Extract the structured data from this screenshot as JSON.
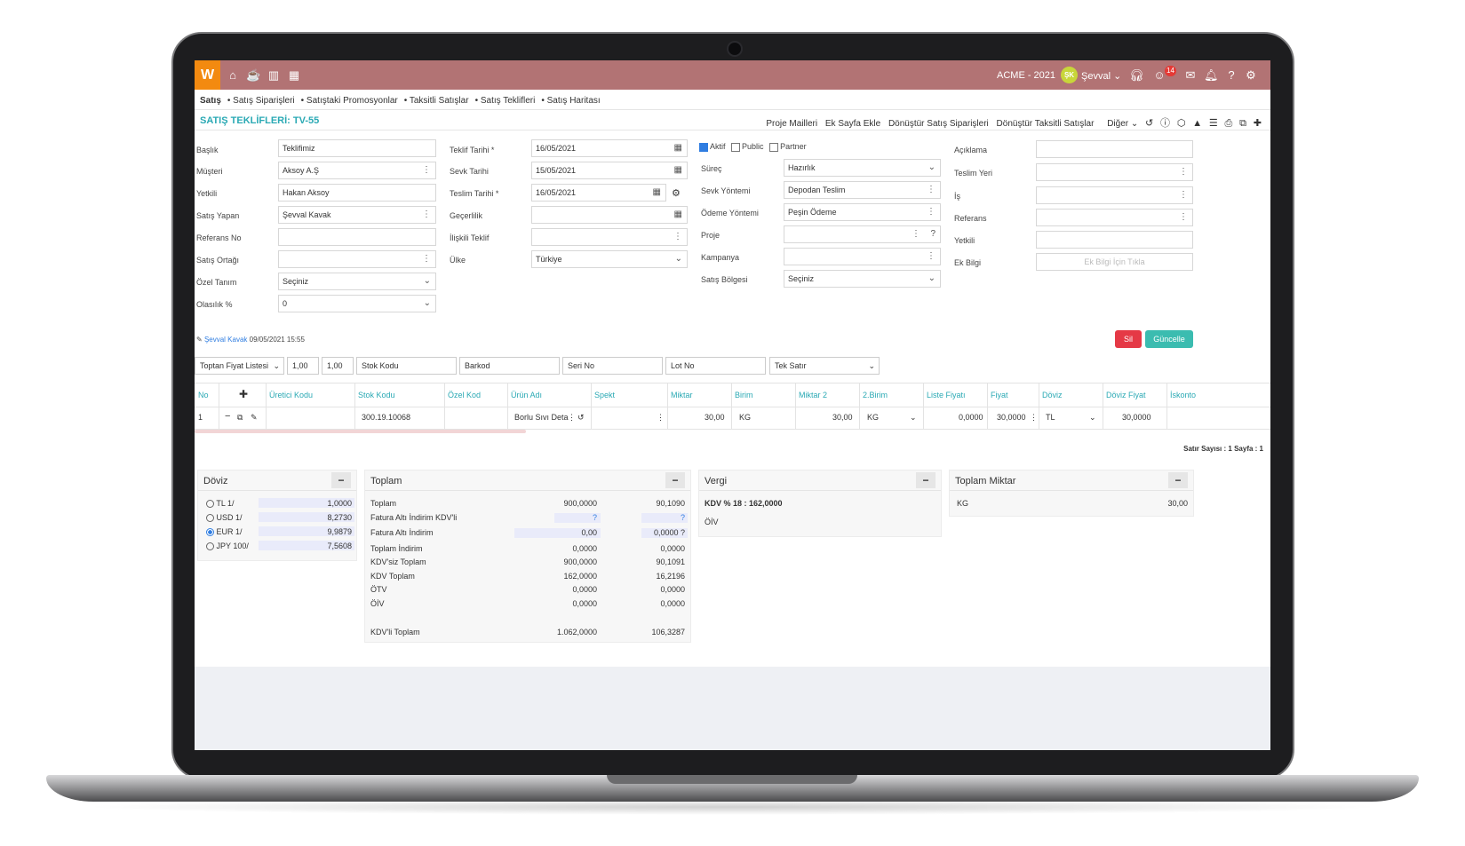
{
  "topbar": {
    "logo": "W",
    "company": "ACME - 2021",
    "avatar_initials": "ŞK",
    "user": "Şevval",
    "notif_count": "14",
    "color": "#b27374",
    "logo_color": "#f38a10",
    "icons": [
      "home-icon",
      "coffee-icon",
      "bar-chart-icon",
      "calendar-icon",
      "headset-icon",
      "smiley-icon",
      "chat-icon",
      "bell-icon",
      "help-icon",
      "gear-icon"
    ]
  },
  "breadcrumb": [
    "Satış",
    "• Satış Siparişleri",
    "• Satıştaki Promosyonlar",
    "• Taksitli Satışlar",
    "• Satış Teklifleri",
    "• Satış Haritası"
  ],
  "page": {
    "title": "SATIŞ TEKLİFLERİ: TV-55",
    "actions": [
      "Proje Mailleri",
      "Ek Sayfa Ekle",
      "Dönüştür Satış Siparişleri",
      "Dönüştür Taksitli Satışlar",
      "Diğer"
    ]
  },
  "form": {
    "col1": [
      {
        "label": "Başlık",
        "value": "Teklifimiz"
      },
      {
        "label": "Müşteri",
        "value": "Aksoy A.Ş"
      },
      {
        "label": "Yetkili",
        "value": "Hakan Aksoy"
      },
      {
        "label": "Satış Yapan",
        "value": "Şevval Kavak"
      },
      {
        "label": "Referans No",
        "value": ""
      },
      {
        "label": "Satış Ortağı",
        "value": ""
      },
      {
        "label": "Özel Tanım",
        "value": "Seçiniz"
      },
      {
        "label": "Olasılık %",
        "value": "0"
      }
    ],
    "col2": [
      {
        "label": "Teklif Tarihi *",
        "value": "16/05/2021"
      },
      {
        "label": "Sevk Tarihi",
        "value": "15/05/2021"
      },
      {
        "label": "Teslim Tarihi *",
        "value": "16/05/2021"
      },
      {
        "label": "Geçerlilik",
        "value": ""
      },
      {
        "label": "İlişkili Teklif",
        "value": ""
      },
      {
        "label": "Ülke",
        "value": "Türkiye"
      }
    ],
    "checks": {
      "aktif": "Aktif",
      "public": "Public",
      "partner": "Partner"
    },
    "col3": [
      {
        "label": "Süreç",
        "value": "Hazırlık"
      },
      {
        "label": "Sevk Yöntemi",
        "value": "Depodan Teslim"
      },
      {
        "label": "Ödeme Yöntemi",
        "value": "Peşin Ödeme"
      },
      {
        "label": "Proje",
        "value": ""
      },
      {
        "label": "Kampanya",
        "value": ""
      },
      {
        "label": "Satış Bölgesi",
        "value": "Seçiniz"
      }
    ],
    "col4": [
      {
        "label": "Açıklama",
        "value": ""
      },
      {
        "label": "Teslim Yeri",
        "value": ""
      },
      {
        "label": "İş",
        "value": ""
      },
      {
        "label": "Referans",
        "value": ""
      },
      {
        "label": "Yetkili",
        "value": ""
      },
      {
        "label": "Ek Bilgi",
        "value": "Ek Bilgi İçin Tıkla"
      }
    ]
  },
  "record": {
    "user": "Şevval Kavak",
    "date": "09/05/2021 15:55"
  },
  "buttons": {
    "delete": "Sil",
    "update": "Güncelle",
    "delete_color": "#e53946",
    "update_color": "#3bbcb0"
  },
  "filters": {
    "price_list": "Toptan Fiyat Listesi",
    "rate1": "1,00",
    "rate2": "1,00",
    "stock": "Stok Kodu",
    "barcode": "Barkod",
    "serial": "Seri No",
    "lot": "Lot No",
    "mode": "Tek Satır"
  },
  "table": {
    "headers": [
      "No",
      "Üretici Kodu",
      "Stok Kodu",
      "Özel Kod",
      "Ürün Adı",
      "Spekt",
      "Miktar",
      "Birim",
      "Miktar 2",
      "2.Birim",
      "Liste Fiyatı",
      "Fiyat",
      "Döviz",
      "Döviz Fiyat",
      "İskonto"
    ],
    "row": {
      "no": "1",
      "stock": "300.19.10068",
      "product": "Borlu Sıvı Deta",
      "qty": "30,00",
      "unit": "KG",
      "qty2": "30,00",
      "unit2": "KG",
      "list_price": "0,0000",
      "price": "30,0000",
      "currency": "TL",
      "fx_price": "30,0000"
    },
    "footer": {
      "rows_label": "Satır Sayısı :",
      "rows": "1",
      "page_label": "Sayfa :",
      "page": "1"
    }
  },
  "doviz": {
    "title": "Döviz",
    "rates": [
      {
        "code": "TL",
        "unit": "1/",
        "value": "1,0000",
        "selected": false
      },
      {
        "code": "USD",
        "unit": "1/",
        "value": "8,2730",
        "selected": false
      },
      {
        "code": "EUR",
        "unit": "1/",
        "value": "9,9879",
        "selected": true
      },
      {
        "code": "JPY",
        "unit": "100/",
        "value": "7,5608",
        "selected": false
      }
    ]
  },
  "toplam": {
    "title": "Toplam",
    "rows": [
      {
        "label": "Toplam",
        "v1": "900,0000",
        "v2": "90,1090"
      },
      {
        "label": "Fatura Altı İndirim KDV'li",
        "v1": "?",
        "v2": "?"
      },
      {
        "label": "Fatura Altı İndirim",
        "v1": "0,00",
        "v2": "0,0000  ?"
      },
      {
        "label": "Toplam İndirim",
        "v1": "0,0000",
        "v2": "0,0000"
      },
      {
        "label": "KDV'siz Toplam",
        "v1": "900,0000",
        "v2": "90,1091"
      },
      {
        "label": "KDV Toplam",
        "v1": "162,0000",
        "v2": "16,2196"
      },
      {
        "label": "ÖTV",
        "v1": "0,0000",
        "v2": "0,0000"
      },
      {
        "label": "ÖİV",
        "v1": "0,0000",
        "v2": "0,0000"
      },
      {
        "label": "KDV'li Toplam",
        "v1": "1.062,0000",
        "v2": "106,3287"
      }
    ]
  },
  "vergi": {
    "title": "Vergi",
    "kdv": "KDV % 18 : 162,0000",
    "oiv": "ÖİV"
  },
  "toplam_miktar": {
    "title": "Toplam Miktar",
    "unit": "KG",
    "value": "30,00"
  }
}
